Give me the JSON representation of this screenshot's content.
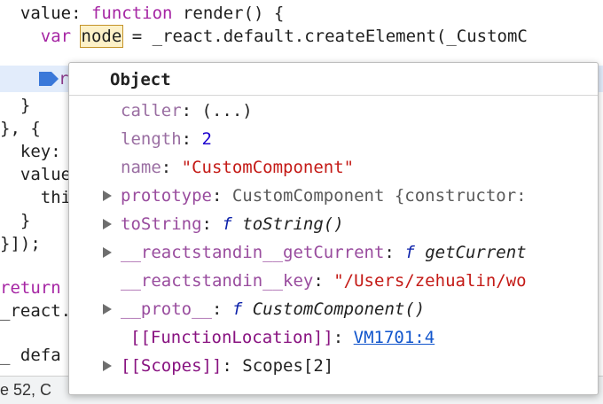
{
  "code": {
    "line1_indent": "  ",
    "line1_key": "value",
    "line1_colon": ": ",
    "line1_kw": "function",
    "line1_rest": " render() {",
    "line2_indent": "    ",
    "line2_kw": "var",
    "line2_node": "node",
    "line2_rest": " = _react.default.createElement(_CustomC",
    "line3_char": "r",
    "line4": "  }",
    "line5": "}, {",
    "line6": "  key:",
    "line7": "  value",
    "line8": "    thi",
    "line9": "  }",
    "line10": "}]);",
    "line11_kw": "return",
    "line12": "_react.",
    "line13": "_ defa"
  },
  "status": {
    "text": "e 52, C"
  },
  "popover": {
    "title": "Object",
    "rows": [
      {
        "key": "caller",
        "sep": ": ",
        "value": "(...)"
      },
      {
        "key": "length",
        "sep": ": ",
        "value": "2"
      },
      {
        "key": "name",
        "sep": ": ",
        "value": "\"CustomComponent\""
      },
      {
        "key": "prototype",
        "sep": ": ",
        "value": "CustomComponent {constructor:"
      },
      {
        "key": "toString",
        "sep": ": ",
        "f": "f",
        "value": " toString()"
      },
      {
        "key": "__reactstandin__getCurrent",
        "sep": ": ",
        "f": "f",
        "value": " getCurrent"
      },
      {
        "key": "__reactstandin__key",
        "sep": ": ",
        "value": "\"/Users/zehualin/wo"
      },
      {
        "key": "__proto__",
        "sep": ": ",
        "f": "f",
        "value": " CustomComponent()"
      },
      {
        "key": "[[FunctionLocation]]",
        "sep": ": ",
        "value": "VM1701:4"
      },
      {
        "key": "[[Scopes]]",
        "sep": ": ",
        "value": "Scopes[2]"
      }
    ]
  },
  "colors": {
    "keyword": "#a626a4",
    "string": "#c41a16",
    "number": "#1c00cf",
    "link": "#1155cc",
    "highlight": "#fdf1c8",
    "exec_line": "#e2ecfb"
  }
}
